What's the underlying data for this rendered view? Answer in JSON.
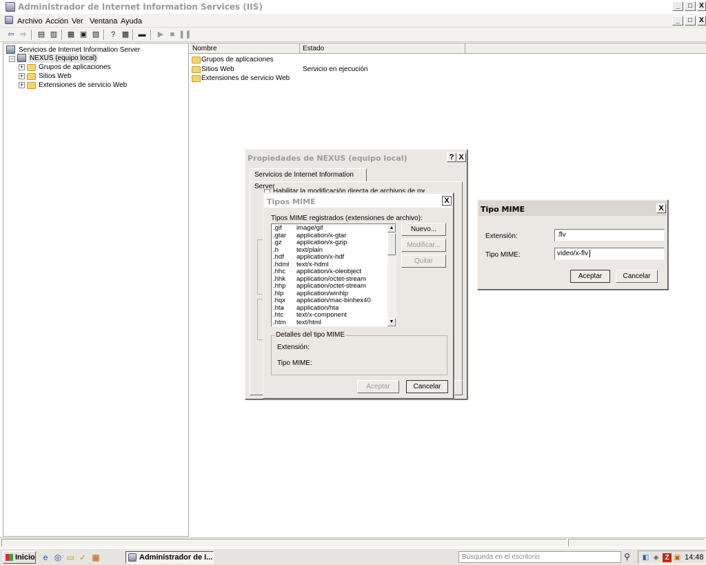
{
  "app": {
    "title": "Administrador de Internet Information Services (IIS)"
  },
  "window_controls": {
    "minimize": "_",
    "maximize": "□",
    "close": "X"
  },
  "menu": [
    "Archivo",
    "Acción",
    "Ver",
    "Ventana",
    "Ayuda"
  ],
  "toolbar": {
    "buttons": [
      "back-icon",
      "forward-icon",
      "up-folder-icon",
      "show-tree-icon",
      "properties-icon",
      "export-icon",
      "refresh-icon",
      "help-icon",
      "console-icon",
      "computer-icon",
      "play-icon",
      "stop-icon",
      "pause-icon"
    ]
  },
  "tree": {
    "root": "Servicios de Internet Information Server",
    "server": "NEXUS (equipo local)",
    "children": [
      "Grupos de aplicaciones",
      "Sitios Web",
      "Extensiones de servicio Web"
    ]
  },
  "list": {
    "columns": [
      "Nombre",
      "Estado"
    ],
    "rows": [
      {
        "name": "Grupos de aplicaciones",
        "status": ""
      },
      {
        "name": "Sitios Web",
        "status": "Servicio en ejecución"
      },
      {
        "name": "Extensiones de servicio Web",
        "status": ""
      }
    ]
  },
  "properties_dialog": {
    "title": "Propiedades de NEXUS (equipo local)",
    "help": "?",
    "close": "X",
    "tab": "Servicios de Internet Information Server",
    "checkbox_label": "Habilitar la modificación directa de archivos de metabase"
  },
  "mime_dialog": {
    "title": "Tipos MIME",
    "close": "X",
    "list_label": "Tipos MIME registrados (extensiones de archivo):",
    "items": [
      {
        "ext": ".gif",
        "type": "image/gif"
      },
      {
        "ext": ".gtar",
        "type": "application/x-gtar"
      },
      {
        "ext": ".gz",
        "type": "application/x-gzip"
      },
      {
        "ext": ".h",
        "type": "text/plain"
      },
      {
        "ext": ".hdf",
        "type": "application/x-hdf"
      },
      {
        "ext": ".hdml",
        "type": "text/x-hdml"
      },
      {
        "ext": ".hhc",
        "type": "application/x-oleobject"
      },
      {
        "ext": ".hhk",
        "type": "application/octet-stream"
      },
      {
        "ext": ".hhp",
        "type": "application/octet-stream"
      },
      {
        "ext": ".hlp",
        "type": "application/winhlp"
      },
      {
        "ext": ".hqx",
        "type": "application/mac-binhex40"
      },
      {
        "ext": ".hta",
        "type": "application/hta"
      },
      {
        "ext": ".htc",
        "type": "text/x-component"
      },
      {
        "ext": ".htm",
        "type": "text/html"
      }
    ],
    "buttons": {
      "new": "Nuevo...",
      "edit": "Modificar...",
      "remove": "Quitar"
    },
    "details": {
      "label": "Detalles del tipo MIME",
      "extension_label": "Extensión:",
      "mime_label": "Tipo MIME:"
    },
    "ok": "Aceptar",
    "cancel": "Cancelar"
  },
  "mime_type_dialog": {
    "title": "Tipo MIME",
    "close": "X",
    "extension_label": "Extensión:",
    "extension_value": ".flv",
    "mime_label": "Tipo MIME:",
    "mime_value": "video/x-flv",
    "ok": "Aceptar",
    "cancel": "Cancelar"
  },
  "taskbar": {
    "start": "Inicio",
    "task": "Administrador de I...",
    "search_placeholder": "Búsqueda en el escritorio",
    "clock": "14:48"
  }
}
